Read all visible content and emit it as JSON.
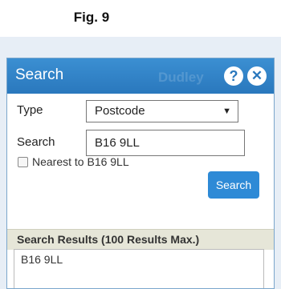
{
  "figure": {
    "label": "Fig. 9"
  },
  "dialog": {
    "title": "Search",
    "icons": {
      "help": "help-icon",
      "close": "close-icon"
    },
    "type_label": "Type",
    "type_value": "Postcode",
    "search_label": "Search",
    "search_value": "B16 9LL",
    "nearest_label": "Nearest to B16 9LL",
    "nearest_checked": false,
    "search_button": "Search",
    "results_header": "Search Results (100 Results Max.)",
    "results": [
      "B16 9LL"
    ],
    "background_text": "Dudley"
  },
  "colors": {
    "titlebar": "#2e86cc",
    "button": "#2e8ad6",
    "results_header_bg": "#e6e6d8"
  }
}
